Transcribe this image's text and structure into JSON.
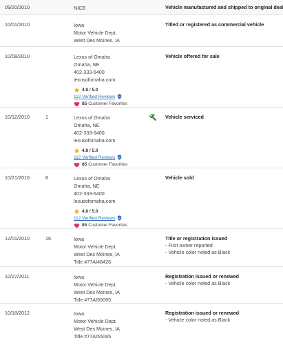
{
  "rows": [
    {
      "date": "09/20/2010",
      "mileage": "",
      "source": [
        "NICB"
      ],
      "title": "Vehicle manufactured and shipped to original dealer",
      "notes": []
    },
    {
      "date": "10/01/2010",
      "mileage": "",
      "source": [
        "Iowa",
        "Motor Vehicle Dept.",
        "West Des Moines, IA"
      ],
      "title": "Titled or registered as commercial vehicle",
      "notes": []
    },
    {
      "date": "10/08/2010",
      "mileage": "",
      "source": [
        "Lexus of Omaha",
        "Omaha, NE",
        "402-333-6400",
        "lexusofomaha.com"
      ],
      "rating": "4.8 / 5.0",
      "reviews": "112 Verified Reviews",
      "favorites_count": "85",
      "favorites_label": "Customer Favorites",
      "title": "Vehicle offered for sale",
      "notes": []
    },
    {
      "date": "10/12/2010",
      "mileage": "1",
      "source": [
        "Lexus of Omaha",
        "Omaha, NE",
        "402-333-6400",
        "lexusofomaha.com"
      ],
      "rating": "4.8 / 5.0",
      "reviews": "112 Verified Reviews",
      "favorites_count": "85",
      "favorites_label": "Customer Favorites",
      "icon": "service-tools-icon",
      "title": "Vehicle serviced",
      "notes": []
    },
    {
      "date": "10/21/2010",
      "mileage": "8",
      "source": [
        "Lexus of Omaha",
        "Omaha, NE",
        "402-333-6400",
        "lexusofomaha.com"
      ],
      "rating": "4.8 / 5.0",
      "reviews": "112 Verified Reviews",
      "favorites_count": "85",
      "favorites_label": "Customer Favorites",
      "title": "Vehicle sold",
      "notes": []
    },
    {
      "date": "12/01/2010",
      "mileage": "16",
      "source": [
        "Iowa",
        "Motor Vehicle Dept.",
        "West Des Moines, IA",
        "Title #77AI48426"
      ],
      "title": "Title or registration issued",
      "notes": [
        "- First owner reported",
        "- Vehicle color noted as Black"
      ]
    },
    {
      "date": "10/27/2011",
      "mileage": "",
      "source": [
        "Iowa",
        "Motor Vehicle Dept.",
        "West Des Moines, IA",
        "Title #77AI55065"
      ],
      "title": "Registration issued or renewed",
      "notes": [
        "- Vehicle color noted as Black"
      ]
    },
    {
      "date": "10/18/2012",
      "mileage": "",
      "source": [
        "Iowa",
        "Motor Vehicle Dept.",
        "West Des Moines, IA",
        "Title #77AI55065"
      ],
      "title": "Registration issued or renewed",
      "notes": [
        "- Vehicle color noted as Black"
      ]
    }
  ],
  "colors": {
    "link": "#2f6fb7",
    "star": "#f2b01e",
    "heart": "#d6336c",
    "shield": "#2f6fb7",
    "service_icon": "#3a8a3a",
    "divider": "#e2e2e2",
    "alt_row": "#f8f8f8"
  }
}
